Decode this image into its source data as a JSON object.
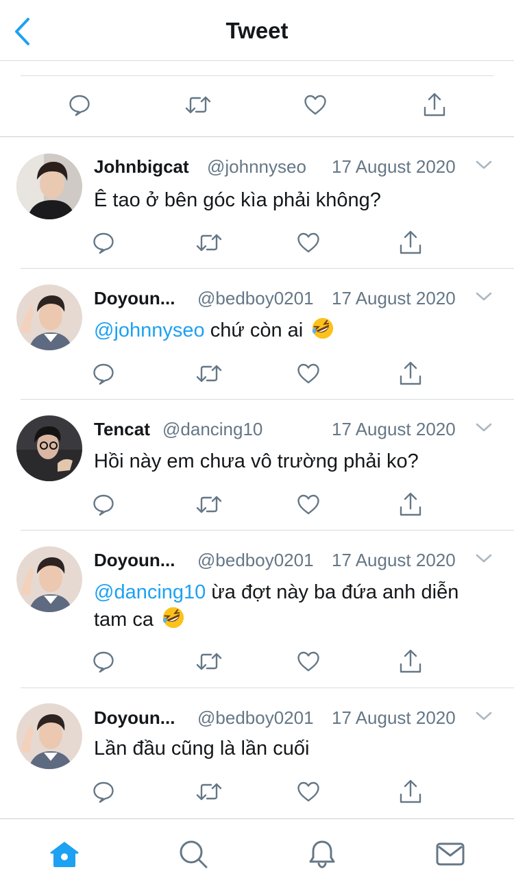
{
  "header": {
    "title": "Tweet",
    "back_icon": "chevron-left-icon"
  },
  "colors": {
    "accent": "#1da1f2",
    "secondary_text": "#657786",
    "icon_gray": "#657786",
    "divider": "#d7dbdf"
  },
  "main_actions": [
    "reply-icon",
    "retweet-icon",
    "like-icon",
    "share-icon"
  ],
  "replies": [
    {
      "name": "Johnbigcat",
      "handle": "@johnnyseo",
      "date": "17 August 2020",
      "mention": "",
      "text": "Ê tao ở bên góc kìa phải không?",
      "text2": "",
      "emoji": ""
    },
    {
      "name": "Doyoun...",
      "handle": "@bedboy0201",
      "date": "17 August 2020",
      "mention": "@johnnyseo",
      "text": " chứ còn ai",
      "text2": "",
      "emoji": "rolling-laughing-emoji"
    },
    {
      "name": "Tencat",
      "handle": "@dancing10",
      "date": "17 August 2020",
      "mention": "",
      "text": "Hồi này em chưa vô trường phải ko?",
      "text2": "",
      "emoji": ""
    },
    {
      "name": "Doyoun...",
      "handle": "@bedboy0201",
      "date": "17 August 2020",
      "mention": "@dancing10",
      "text": " ừa đợt này ba đứa anh diễn",
      "text2": "tam ca",
      "emoji": "rolling-laughing-emoji"
    },
    {
      "name": "Doyoun...",
      "handle": "@bedboy0201",
      "date": "17 August 2020",
      "mention": "",
      "text": "Lần đầu cũng là lần cuối",
      "text2": "",
      "emoji": ""
    }
  ],
  "tabbar": [
    "home-icon",
    "search-icon",
    "notifications-icon",
    "messages-icon"
  ]
}
